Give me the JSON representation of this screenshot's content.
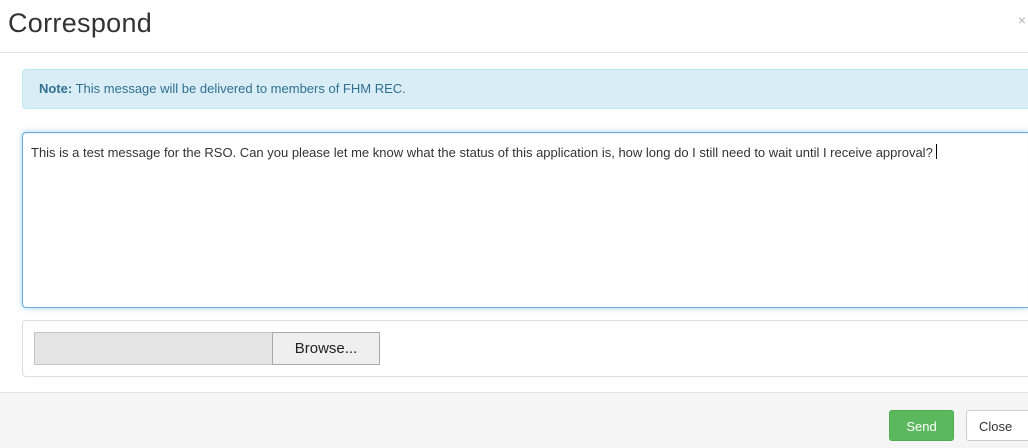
{
  "dialog": {
    "title": "Correspond",
    "close_glyph": "×",
    "close_icon": "close-icon"
  },
  "note": {
    "label": "Note:",
    "text": " This message will be delivered to members of FHM REC."
  },
  "message": {
    "value": "This is a test message for the RSO. Can you please let me know what the status of this application is, how long do I still need to wait until I receive approval?"
  },
  "upload": {
    "file_path_value": "",
    "browse_label": "Browse..."
  },
  "footer": {
    "send_label": "Send",
    "close_label": "Close"
  },
  "colors": {
    "note_background": "#d9edf7",
    "note_text": "#31708f",
    "send_button": "#5cb85c",
    "focus_border": "#66afe9"
  }
}
